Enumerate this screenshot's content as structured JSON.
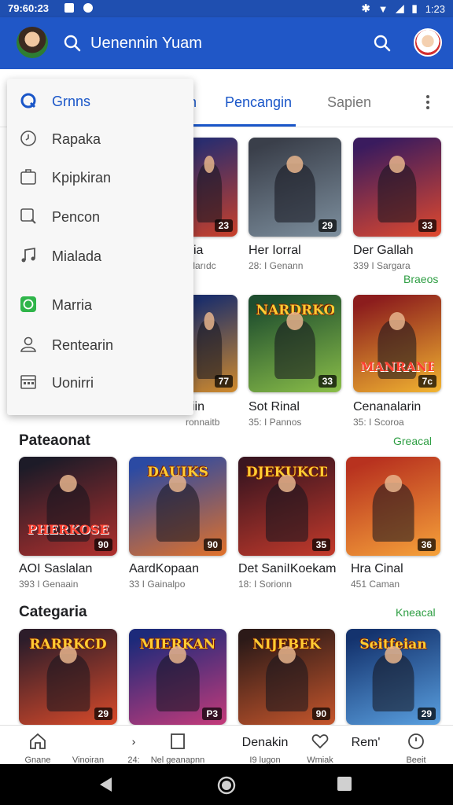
{
  "status_bar": {
    "time": "79:60:23",
    "clock": "1:23"
  },
  "app_bar": {
    "search_text": "Uenennin Yuam"
  },
  "tabs": [
    {
      "label": "n"
    },
    {
      "label": "Pencangin"
    },
    {
      "label": "Sapien"
    }
  ],
  "drawer": {
    "items": [
      {
        "label": "Grnns",
        "icon": "q-icon"
      },
      {
        "label": "Rapaka",
        "icon": "clock-icon"
      },
      {
        "label": "Kpipkiran",
        "icon": "briefcase-icon"
      },
      {
        "label": "Pencon",
        "icon": "search-icon"
      },
      {
        "label": "Mialada",
        "icon": "music-note-icon"
      },
      {
        "label": "Marria",
        "icon": "whatsapp-icon"
      },
      {
        "label": "Rentearin",
        "icon": "person-icon"
      },
      {
        "label": "Uonirri",
        "icon": "calendar-icon"
      }
    ]
  },
  "top_grid": {
    "rows": [
      [
        {
          "title": "ia",
          "meta": "inlarıdc",
          "badge": "23",
          "colors": [
            "#2b2d6e",
            "#c9402a"
          ]
        },
        {
          "title": "Her Iorral",
          "meta": "28: I Genann",
          "badge": "29",
          "colors": [
            "#3a3f4a",
            "#7d8f9e"
          ]
        },
        {
          "title": "Der Gallah",
          "meta": "339 I Sargara",
          "badge": "33",
          "colors": [
            "#3a1b5e",
            "#e0492e"
          ]
        }
      ],
      [
        {
          "title": "iin",
          "meta": "ronnaitb",
          "badge": "77",
          "colors": [
            "#1d2f6a",
            "#d08a2c"
          ]
        },
        {
          "title": "Sot Rinal",
          "meta": "35: I Pannos",
          "badge": "33",
          "colors": [
            "#1e4d2e",
            "#8bbf49"
          ]
        },
        {
          "title": "Cenanalarin",
          "meta": "35: I Scoroa",
          "badge": "7c",
          "colors": [
            "#8c1d1d",
            "#f2b531"
          ]
        }
      ]
    ],
    "link": "Braeos"
  },
  "banner_text": {
    "nitro": "NARDRKOS",
    "rmanbar": "MANRANBAR"
  },
  "section_1": {
    "title": "Pateaonat",
    "link": "Greacal",
    "cards": [
      {
        "title": "AOI Saslalan",
        "meta": "393 I Genaain",
        "badge": "90",
        "banner": "PHERKOSE",
        "colors": [
          "#1d1b28",
          "#b0302d"
        ]
      },
      {
        "title": "AardKopaan",
        "meta": "33 I Gainalpo",
        "badge": "90",
        "banner": "DAUIKS",
        "colors": [
          "#2b4aa3",
          "#e1712a"
        ]
      },
      {
        "title": "Det SaniIKoekam",
        "meta": "18: I Sorionn",
        "badge": "35",
        "banner": "DJEKUKCD",
        "colors": [
          "#3a1520",
          "#c43a2b"
        ]
      },
      {
        "title": "Hra Cinal",
        "meta": "451 Caman",
        "badge": "36",
        "banner": "",
        "colors": [
          "#b8321f",
          "#f6a23a"
        ]
      }
    ]
  },
  "section_2": {
    "title": "Categaria",
    "link": "Kneacal",
    "cards": [
      {
        "badge": "29",
        "banner": "RARRKCD",
        "colors": [
          "#2d1d2a",
          "#d94a2a"
        ]
      },
      {
        "badge": "P3",
        "banner": "MIERKAN",
        "colors": [
          "#1d2a7a",
          "#c43b7a"
        ]
      },
      {
        "badge": "90",
        "banner": "NIJEBEK",
        "colors": [
          "#2c1a18",
          "#c6562c"
        ]
      },
      {
        "badge": "29",
        "banner": "Seitfeian",
        "colors": [
          "#14336e",
          "#5aa0e0"
        ]
      }
    ]
  },
  "bottom_nav": [
    {
      "label": "Gnane",
      "icon": "home-icon"
    },
    {
      "label": "Vinoiran",
      "icon": ""
    },
    {
      "label": "24:",
      "icon": "chevron-icon"
    },
    {
      "label": "Nel geanapnn",
      "icon": "square-icon"
    },
    {
      "label": "I9 lugon",
      "big": "Denakin"
    },
    {
      "label": "Wmiak",
      "icon": "heart-icon"
    },
    {
      "label": "",
      "big": "Rem'"
    },
    {
      "label": "Beeit",
      "icon": "clock-icon"
    }
  ],
  "colors": {
    "app_bar": "#2057c7",
    "accent": "#1a56c8",
    "link_green": "#2e9e43"
  }
}
